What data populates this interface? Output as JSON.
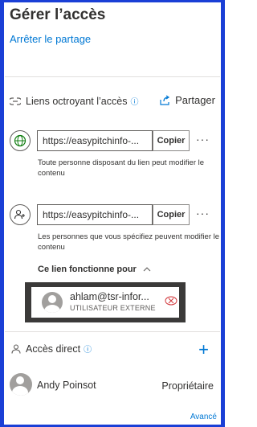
{
  "panel": {
    "title": "Gérer l’accès",
    "stop_sharing": "Arrêter le partage"
  },
  "links_section": {
    "heading": "Liens octroyant l’accès",
    "share_label": "Partager",
    "links": [
      {
        "icon": "globe-icon",
        "url": "https://easypitchinfo-...",
        "copy_label": "Copier",
        "more": "···",
        "description": "Toute personne disposant du lien peut modifier le contenu"
      },
      {
        "icon": "people-icon",
        "url": "https://easypitchinfo-...",
        "copy_label": "Copier",
        "more": "···",
        "description": "Les personnes que vous spécifiez peuvent modifier le contenu"
      }
    ],
    "works_for_label": "Ce lien fonctionne pour",
    "person": {
      "name": "ahlam@tsr-infor...",
      "role": "UTILISATEUR EXTERNE"
    }
  },
  "direct_access": {
    "heading": "Accès direct",
    "add_label": "+",
    "owner": {
      "name": "Andy Poinsot",
      "role": "Propriétaire"
    }
  },
  "footer": {
    "advanced_label": "Avancé"
  },
  "colors": {
    "accent": "#0078d4",
    "frame": "#1a3fd6",
    "remove": "#d13438"
  }
}
